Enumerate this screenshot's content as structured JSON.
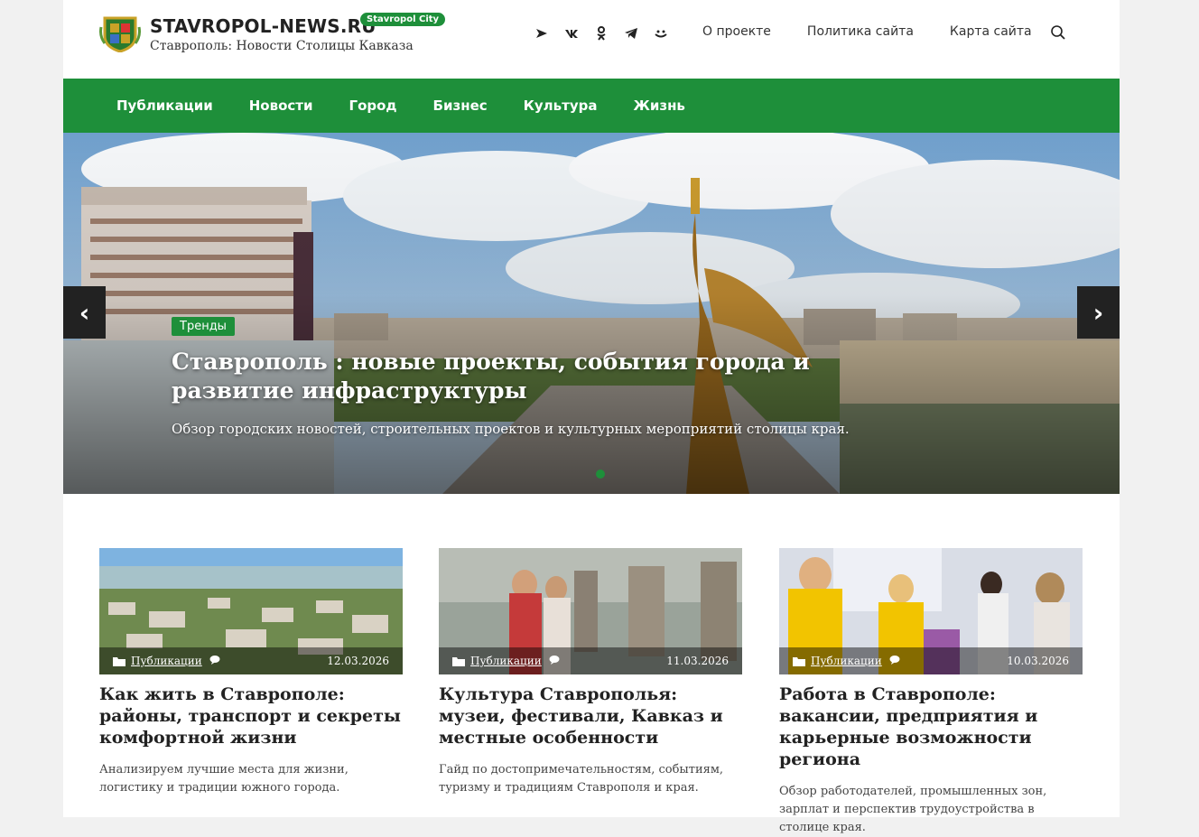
{
  "header": {
    "site_name": "STAVROPOL-NEWS.RU",
    "city_badge": "Stavropol City",
    "tagline": "Ставрополь: Новости Столицы Кавказа",
    "social_icons": [
      "zen-icon",
      "vk-icon",
      "ok-icon",
      "telegram-icon",
      "max-icon"
    ],
    "links": [
      "О проекте",
      "Политика сайта",
      "Карта сайта"
    ]
  },
  "nav": {
    "items": [
      "Публикации",
      "Новости",
      "Город",
      "Бизнес",
      "Культура",
      "Жизнь"
    ]
  },
  "hero": {
    "tag": "Тренды",
    "title": "Ставрополь : новые проекты, события города и развитие инфраструктуры",
    "description": "Обзор городских новостей, строительных проектов и культурных мероприятий столицы края.",
    "prev_arrow": "‹",
    "next_arrow": "›"
  },
  "cards": [
    {
      "category": "Публикации",
      "date": "12.03.2026",
      "title": "Как жить в Ставрополе: районы, транспорт и секреты комфортной жизни",
      "excerpt": "Анализируем лучшие места для жизни, логистику и традиции южного города."
    },
    {
      "category": "Публикации",
      "date": "11.03.2026",
      "title": "Культура Ставрополья: музеи, фестивали, Кавказ и местные особенности",
      "excerpt": "Гайд по достопримечательностям, событиям, туризму и традициям Ставрополя и края."
    },
    {
      "category": "Публикации",
      "date": "10.03.2026",
      "title": "Работа в Ставрополе: вакансии, предприятия и карьерные возможности региона",
      "excerpt": "Обзор работодателей, промышленных зон, зарплат и перспектив трудоустройства в столице края."
    }
  ],
  "colors": {
    "brand_green": "#1e8f3a",
    "text_dark": "#222222"
  }
}
